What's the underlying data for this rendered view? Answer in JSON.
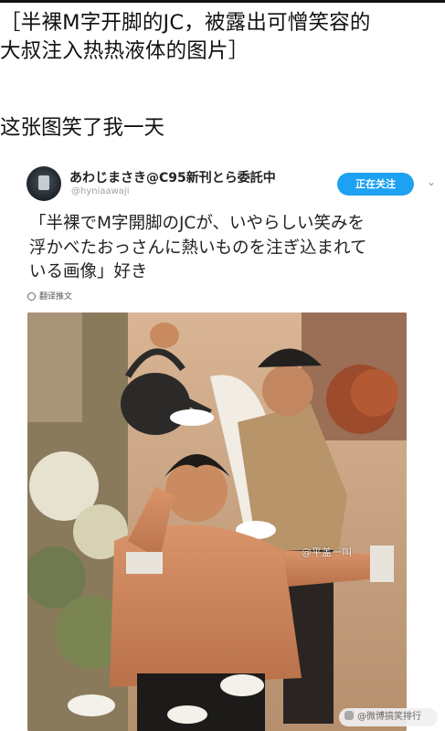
{
  "post": {
    "title": "［半裸M字开脚的JC，被露出可憎笑容的\n大叔注入热热液体的图片］",
    "caption": "这张图笑了我一天"
  },
  "tweet": {
    "display_name": "あわじまさき@C95新刊とら委託中",
    "handle": "@hyniaawaji",
    "follow_label": "正在关注",
    "text": "「半裸でM字開脚のJCが、いやらしい笑みを\n浮かべたおっさんに熱いものを注ぎ込まれて\nいる画像」好き",
    "translate_label": "翻译推文",
    "more_icon": "chevron-down-icon",
    "accent_color": "#1da1f2"
  },
  "watermark": {
    "text": "@平盖一叫"
  },
  "share_badge": {
    "text": "@微博搞笑排行"
  }
}
